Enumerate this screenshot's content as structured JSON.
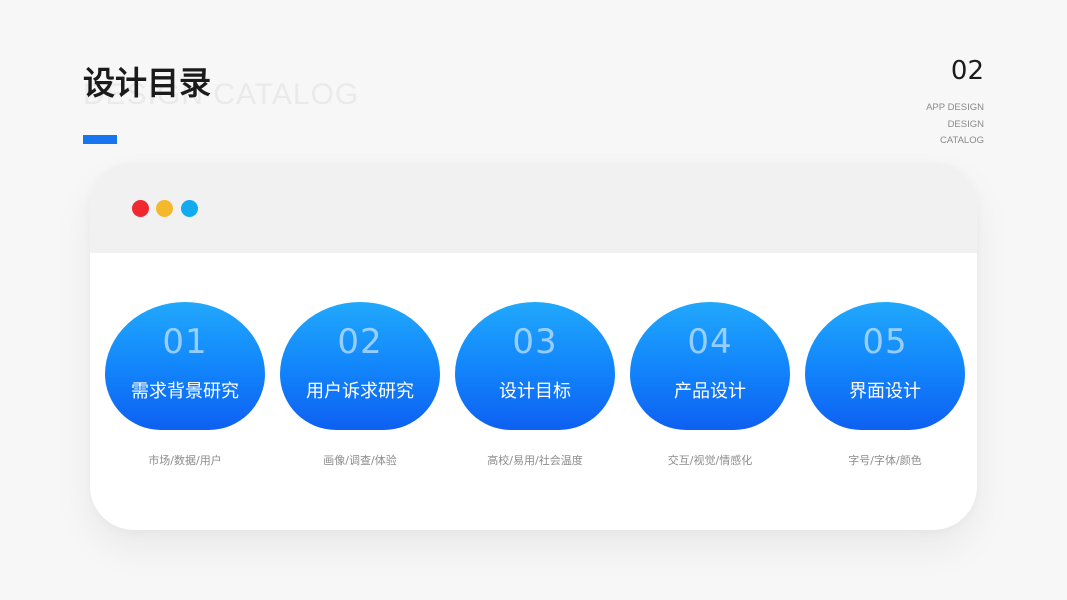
{
  "header": {
    "title_cn": "设计目录",
    "title_en": "DESIGN CATALOG",
    "page_number": "02",
    "subtitle_lines": [
      "APP DESIGN",
      "DESIGN",
      "CATALOG"
    ],
    "accent_color": "#1775f0"
  },
  "window": {
    "dots": [
      {
        "name": "red",
        "color": "#f02830"
      },
      {
        "name": "yellow",
        "color": "#f5b82a"
      },
      {
        "name": "blue",
        "color": "#14aaf0"
      }
    ]
  },
  "items": [
    {
      "num": "01",
      "label": "需求背景研究",
      "desc": "市场/数据/用户"
    },
    {
      "num": "02",
      "label": "用户诉求研究",
      "desc": "画像/调查/体验"
    },
    {
      "num": "03",
      "label": "设计目标",
      "desc": "高校/易用/社会温度"
    },
    {
      "num": "04",
      "label": "产品设计",
      "desc": "交互/视觉/情感化"
    },
    {
      "num": "05",
      "label": "界面设计",
      "desc": "字号/字体/颜色"
    }
  ],
  "colors": {
    "blob_top": "#21a8fc",
    "blob_bottom": "#0e60f2"
  }
}
